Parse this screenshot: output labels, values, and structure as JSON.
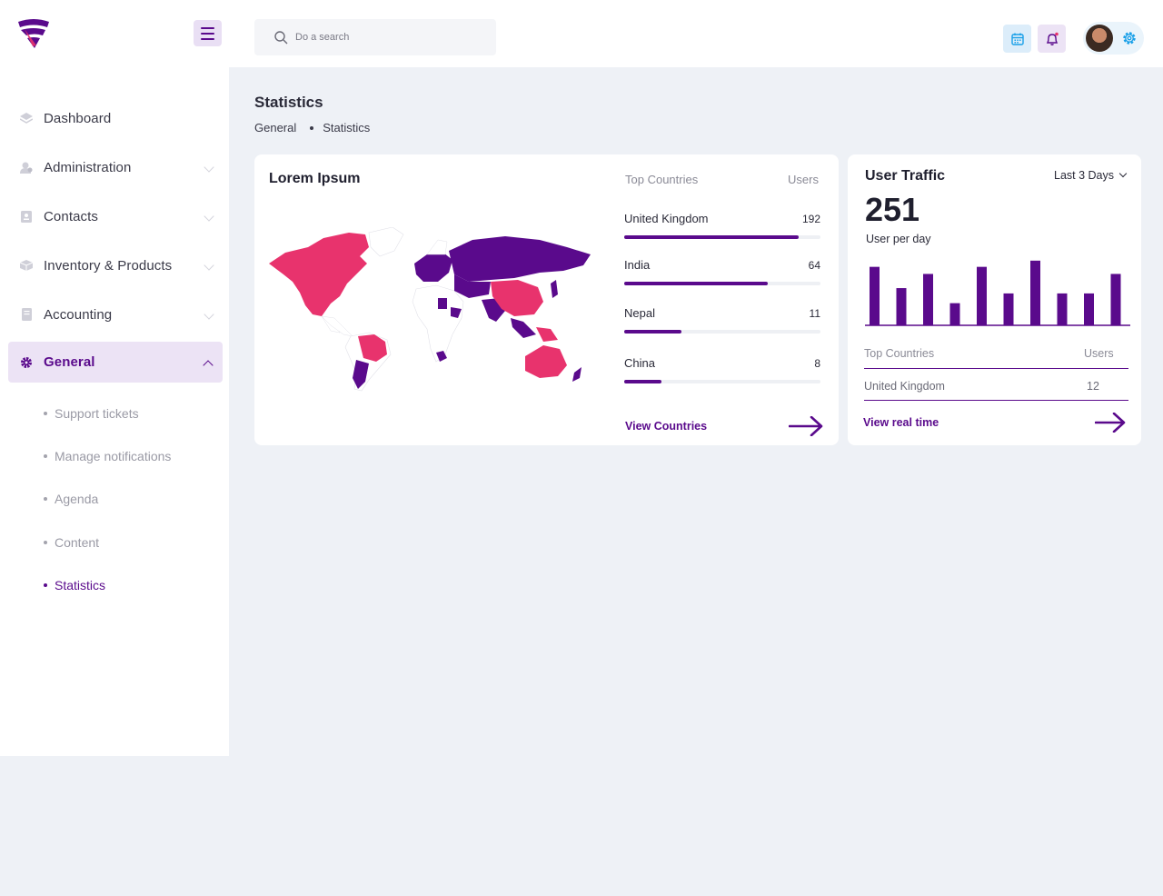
{
  "colors": {
    "accent": "#5a0a8c",
    "highlight": "#e8336d",
    "sidebar_active_bg": "#ece3f5",
    "page_bg": "#eef1f6"
  },
  "sidebar": {
    "items": [
      {
        "label": "Dashboard",
        "icon": "dashboard-icon",
        "expandable": false
      },
      {
        "label": "Administration",
        "icon": "admin-icon",
        "expandable": true
      },
      {
        "label": "Contacts",
        "icon": "contacts-icon",
        "expandable": true
      },
      {
        "label": "Inventory & Products",
        "icon": "box-icon",
        "expandable": true
      },
      {
        "label": "Accounting",
        "icon": "ledger-icon",
        "expandable": true
      },
      {
        "label": "General",
        "icon": "gear-icon",
        "expandable": true,
        "active": true
      }
    ],
    "subitems": [
      {
        "label": "Support tickets"
      },
      {
        "label": "Manage notifications"
      },
      {
        "label": "Agenda"
      },
      {
        "label": "Content"
      },
      {
        "label": "Statistics",
        "active": true
      }
    ]
  },
  "header": {
    "search_placeholder": "Do a search",
    "buttons": [
      "calendar-icon",
      "bell-icon",
      "avatar",
      "gear-icon"
    ]
  },
  "page": {
    "title": "Statistics",
    "breadcrumb": [
      "General",
      "Statistics"
    ]
  },
  "map_card": {
    "title": "Lorem Ipsum",
    "col_country": "Top Countries",
    "col_users": "Users",
    "countries": [
      {
        "name": "United Kingdom",
        "users": "192",
        "fraction": 0.89
      },
      {
        "name": "India",
        "users": "64",
        "fraction": 0.73
      },
      {
        "name": "Nepal",
        "users": "11",
        "fraction": 0.29
      },
      {
        "name": "China",
        "users": "8",
        "fraction": 0.19
      }
    ],
    "link": "View Countries"
  },
  "traffic_card": {
    "title": "User Traffic",
    "range": "Last 3 Days",
    "total": "251",
    "subtitle": "User per day",
    "col_country": "Top Countries",
    "col_users": "Users",
    "row_country": "United Kingdom",
    "row_users": "12",
    "link": "View real time"
  },
  "chart_data": {
    "type": "bar",
    "values": [
      66,
      42,
      58,
      25,
      66,
      36,
      73,
      36,
      36,
      58
    ],
    "ylim": [
      0,
      80
    ],
    "grid": false,
    "title": "",
    "xlabel": "",
    "ylabel": ""
  }
}
